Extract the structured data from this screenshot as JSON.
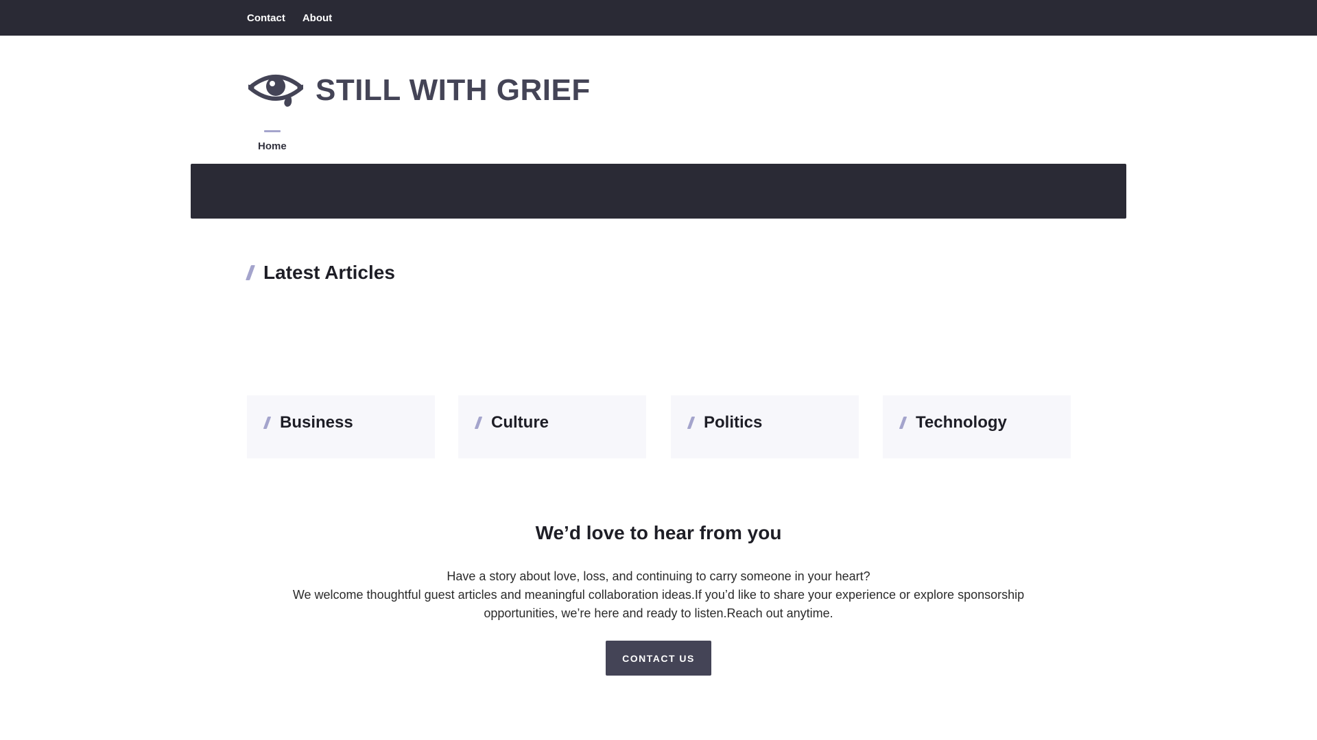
{
  "topbar": {
    "links": [
      {
        "label": "Contact"
      },
      {
        "label": "About"
      }
    ]
  },
  "brand": {
    "name": "STILL WITH GRIEF",
    "logo_icon": "crying-eye-icon",
    "color": "#444456"
  },
  "main_nav": {
    "items": [
      {
        "label": "Home",
        "active": true
      }
    ]
  },
  "latest": {
    "title": "Latest Articles"
  },
  "categories": [
    {
      "label": "Business"
    },
    {
      "label": "Culture"
    },
    {
      "label": "Politics"
    },
    {
      "label": "Technology"
    }
  ],
  "contact": {
    "heading": "We’d love to hear from you",
    "line1": "Have a story about love, loss, and continuing to carry someone in your heart?",
    "line2": "We welcome thoughtful guest articles and meaningful collaboration ideas.If you’d like to share your experience or explore sponsorship opportunities, we’re here and ready to listen.Reach out anytime.",
    "button_label": "CONTACT US"
  },
  "colors": {
    "dark": "#2a2a35",
    "accent": "#a4a4cc",
    "card_bg": "#f7f7fb"
  }
}
